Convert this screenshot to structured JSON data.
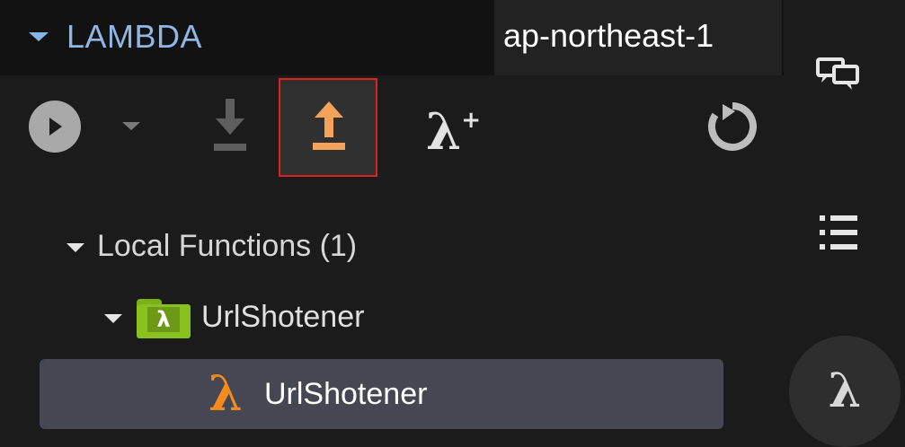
{
  "header": {
    "title": "LAMBDA",
    "region": "ap-northeast-1"
  },
  "toolbar": {
    "buttons": [
      {
        "name": "run",
        "icon": "play-circle-icon"
      },
      {
        "name": "run-menu",
        "icon": "chevron-down-icon"
      },
      {
        "name": "download",
        "icon": "download-icon"
      },
      {
        "name": "upload",
        "icon": "upload-icon",
        "selected": true
      },
      {
        "name": "create",
        "icon": "lambda-plus-icon"
      },
      {
        "name": "refresh",
        "icon": "refresh-icon"
      }
    ],
    "create_icon_glyph": "λ",
    "create_icon_plus": "+"
  },
  "tree": {
    "group_label": "Local Functions (1)",
    "folder": {
      "label": "UrlShotener",
      "icon_glyph": "λ"
    },
    "function": {
      "label": "UrlShotener",
      "icon_glyph": "λ"
    }
  },
  "activity_bar": {
    "items": [
      {
        "name": "feedback",
        "icon": "chat-bubbles-icon"
      },
      {
        "name": "list",
        "icon": "list-icon"
      },
      {
        "name": "lambda",
        "icon": "lambda-icon",
        "glyph": "λ"
      }
    ]
  },
  "colors": {
    "background": "#1b1b1b",
    "header": "#121212",
    "title": "#8fb6e4",
    "selection": "#454752",
    "accent_orange": "#f58a1f",
    "folder_green": "#89c21f",
    "upload_border": "#e01f1f"
  }
}
